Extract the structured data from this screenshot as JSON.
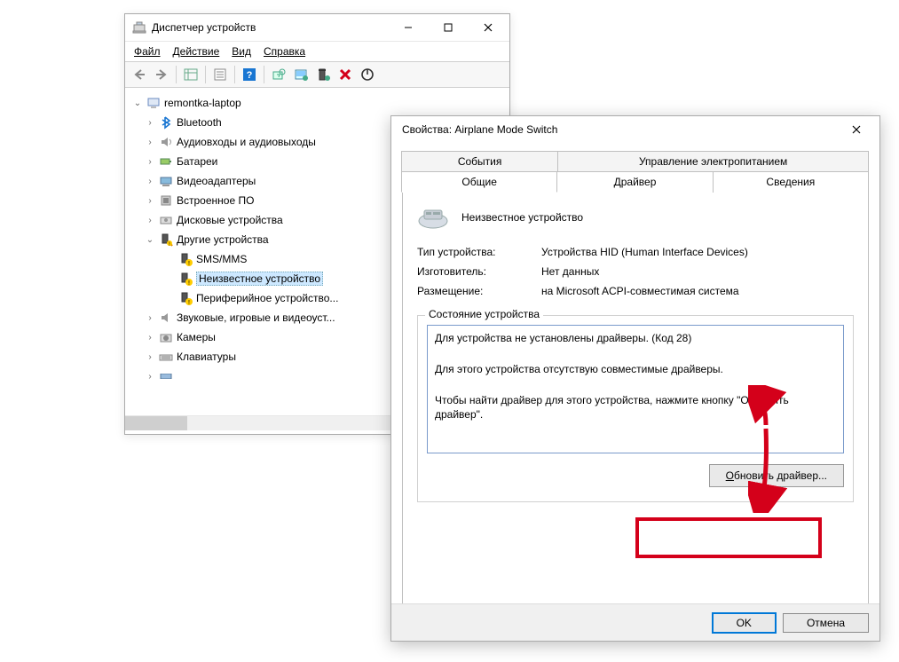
{
  "device_manager": {
    "title": "Диспетчер устройств",
    "menu": {
      "file": "Файл",
      "action": "Действие",
      "view": "Вид",
      "help": "Справка"
    },
    "root": "remontka-laptop",
    "nodes": {
      "bluetooth": "Bluetooth",
      "audio": "Аудиовходы и аудиовыходы",
      "batteries": "Батареи",
      "video": "Видеоадаптеры",
      "firmware": "Встроенное ПО",
      "disk": "Дисковые устройства",
      "other": "Другие устройства",
      "sms": "SMS/MMS",
      "unknown": "Неизвестное устройство",
      "peripheral": "Периферийное устройство...",
      "sound": "Звуковые, игровые и видеоуст...",
      "cameras": "Камеры",
      "keyboards": "Клавиатуры"
    }
  },
  "props": {
    "title": "Свойства: Airplane Mode Switch",
    "tabs": {
      "events": "События",
      "power": "Управление электропитанием",
      "general": "Общие",
      "driver": "Драйвер",
      "details": "Сведения"
    },
    "device_name": "Неизвестное устройство",
    "rows": {
      "type_label": "Тип устройства:",
      "type_value": "Устройства HID (Human Interface Devices)",
      "manufacturer_label": "Изготовитель:",
      "manufacturer_value": "Нет данных",
      "location_label": "Размещение:",
      "location_value": "на Microsoft ACPI-совместимая система"
    },
    "status_group": "Состояние устройства",
    "status_lines": [
      "Для устройства не установлены драйверы. (Код 28)",
      "Для этого устройства отсутствую совместимые драйверы.",
      "Чтобы найти драйвер для этого устройства, нажмите кнопку \"Обновить драйвер\"."
    ],
    "update_btn": "Обновить драйвер...",
    "ok": "OK",
    "cancel": "Отмена"
  }
}
